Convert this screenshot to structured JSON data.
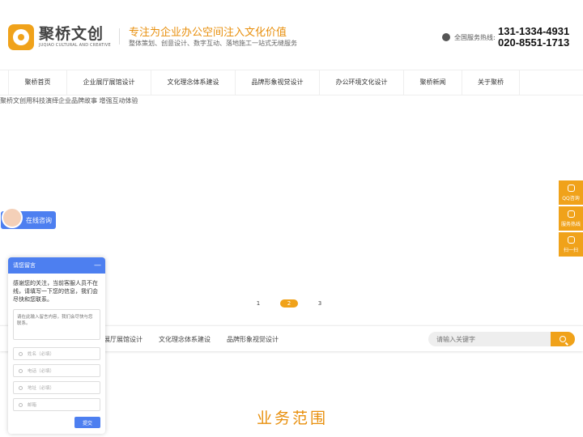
{
  "header": {
    "logo_cn": "聚桥文创",
    "logo_en": "JUQIAO CULTURAL AND CREATIVE",
    "slogan_main": "专注为企业办公空间注入文化价值",
    "slogan_sub": "整体策划、创意设计、数字互动、落地施工一站式无缝服务",
    "hotline_label": "全国服务热线:",
    "phone_1": "131-1334-4931",
    "phone_2": "020-8551-1713"
  },
  "nav": {
    "items": [
      {
        "label": "聚桥首页"
      },
      {
        "label": "企业展厅展馆设计"
      },
      {
        "label": "文化理念体系建设"
      },
      {
        "label": "品牌形象视觉设计"
      },
      {
        "label": "办公环境文化设计"
      },
      {
        "label": "聚桥新闻"
      },
      {
        "label": "关于聚桥"
      }
    ]
  },
  "banner": {
    "alt_text": "聚桥文创用科技演绎企业品牌故事 增强互动体验",
    "dots": [
      "1",
      "2",
      "3"
    ],
    "active_dot": 1
  },
  "strip": {
    "links": [
      "展厅展馆设计",
      "文化理念体系建设",
      "品牌形象视觉设计"
    ],
    "search_placeholder": "请输入关键字"
  },
  "section": {
    "title": "业务范围"
  },
  "float_bar": {
    "items": [
      {
        "label": "QQ咨询",
        "icon": "qq-icon"
      },
      {
        "label": "服务热线",
        "icon": "phone-icon"
      },
      {
        "label": "扫一扫",
        "icon": "qrcode-icon"
      }
    ]
  },
  "chat": {
    "pill_label": "在线咨询",
    "widget_title": "请您留言",
    "minimize": "—",
    "intro": "感谢您的关注，当前客服人员不在线，请填写一下您的信息，我们会尽快和您联系。",
    "message_placeholder": "请在此输入留言内容，我们会尽快与您联系。",
    "fields": [
      "姓名（必填）",
      "电话（必填）",
      "地址（必填）",
      "邮箱"
    ],
    "submit_label": "提交"
  },
  "colors": {
    "accent": "#f0a21a",
    "chat_blue": "#4d7ff0"
  }
}
